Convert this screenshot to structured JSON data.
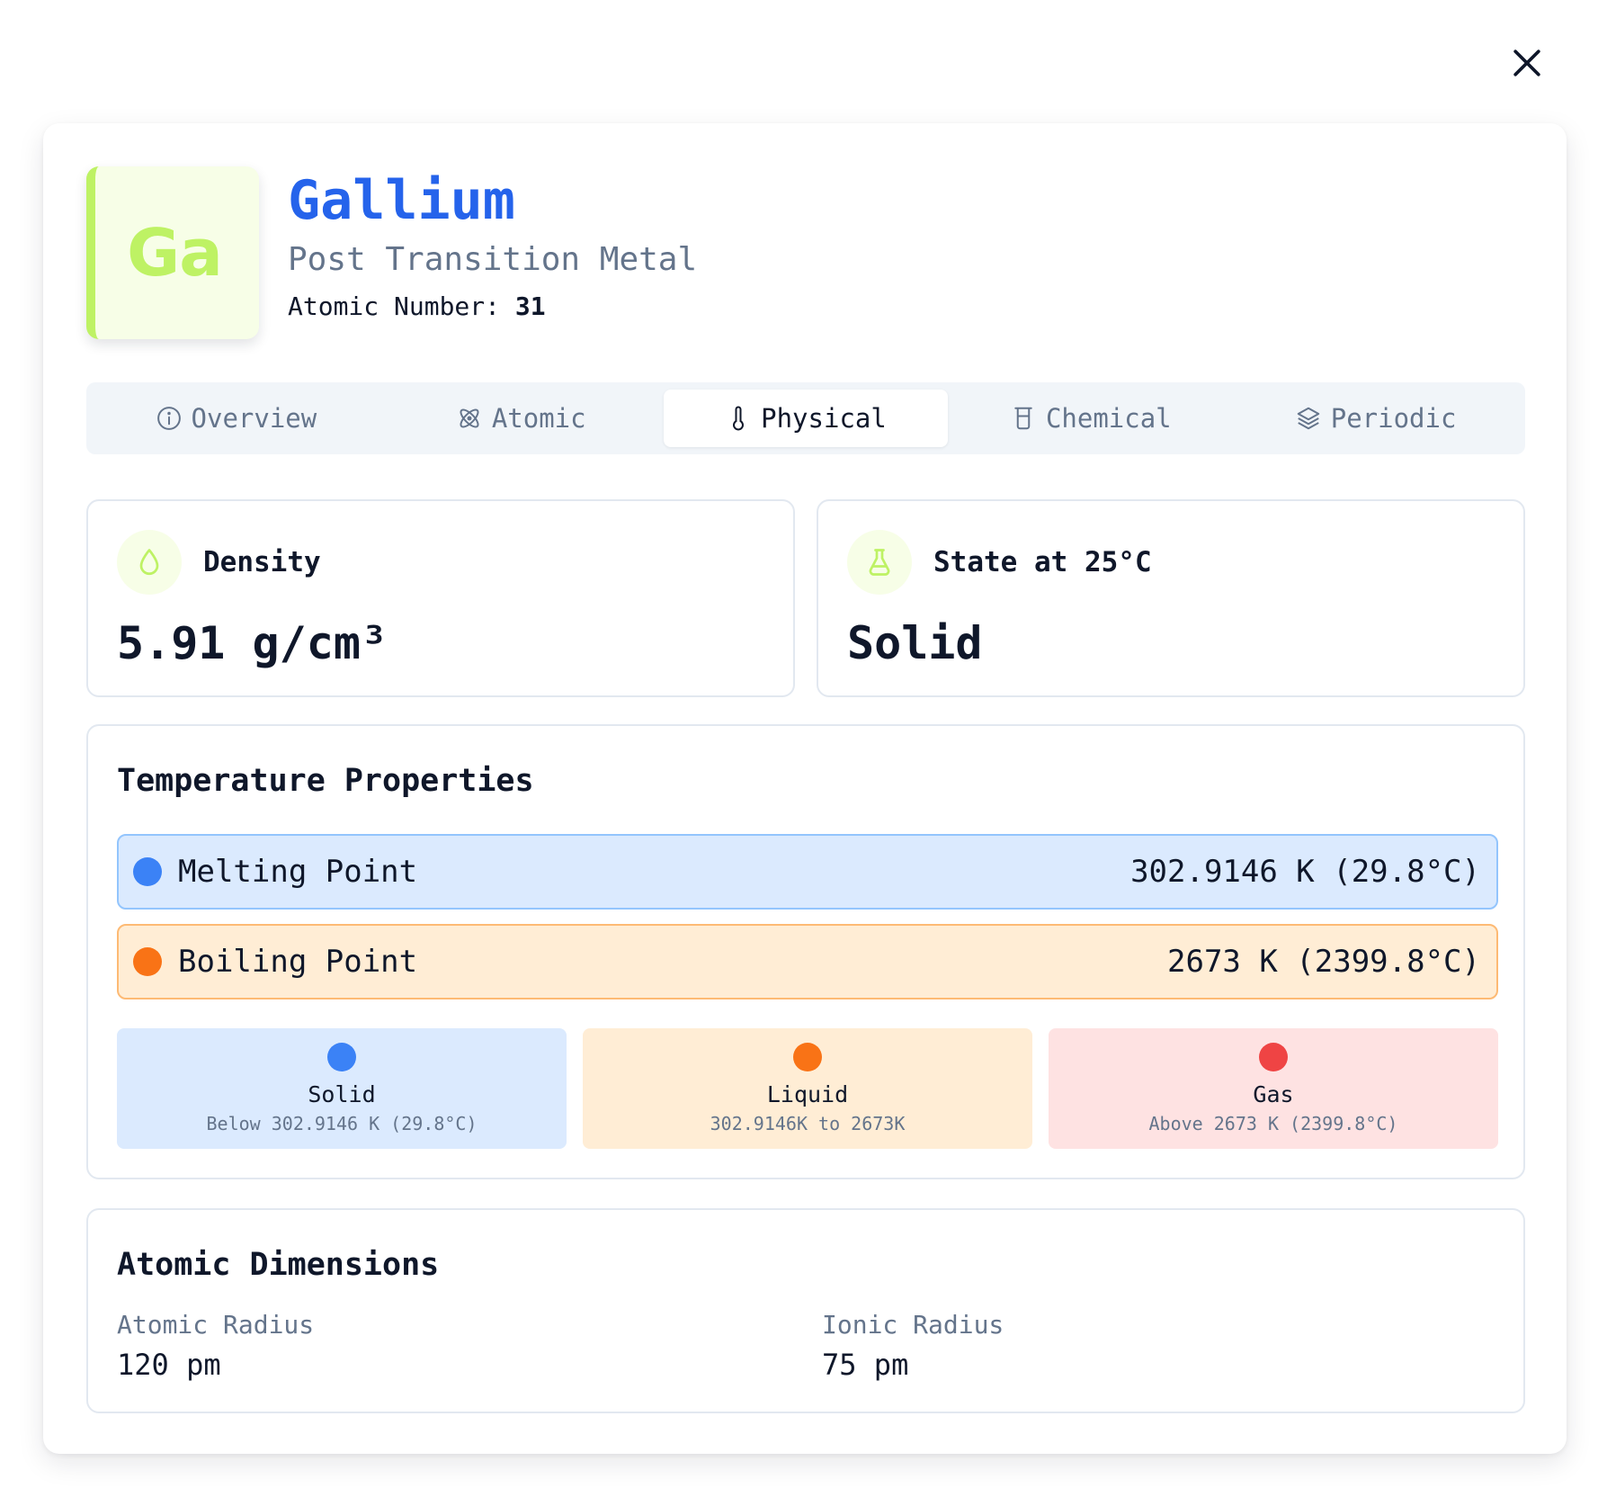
{
  "header": {
    "symbol": "Ga",
    "name": "Gallium",
    "category": "Post Transition Metal",
    "atomic_number_label": "Atomic Number:",
    "atomic_number": "31"
  },
  "tabs": [
    {
      "label": "Overview",
      "icon": "info-icon",
      "active": false
    },
    {
      "label": "Atomic",
      "icon": "atom-icon",
      "active": false
    },
    {
      "label": "Physical",
      "icon": "thermometer-icon",
      "active": true
    },
    {
      "label": "Chemical",
      "icon": "beaker-icon",
      "active": false
    },
    {
      "label": "Periodic",
      "icon": "layers-icon",
      "active": false
    }
  ],
  "density": {
    "label": "Density",
    "value": "5.91 g/cm³",
    "icon": "droplet-icon"
  },
  "state": {
    "label": "State at 25°C",
    "value": "Solid",
    "icon": "flask-icon"
  },
  "temperature": {
    "title": "Temperature Properties",
    "melting": {
      "label": "Melting Point",
      "value": "302.9146 K (29.8°C)"
    },
    "boiling": {
      "label": "Boiling Point",
      "value": "2673 K (2399.8°C)"
    },
    "phases": [
      {
        "name": "Solid",
        "range": "Below 302.9146 K (29.8°C)"
      },
      {
        "name": "Liquid",
        "range": "302.9146K to 2673K"
      },
      {
        "name": "Gas",
        "range": "Above 2673 K (2399.8°C)"
      }
    ]
  },
  "dimensions": {
    "title": "Atomic Dimensions",
    "atomic_radius_label": "Atomic Radius",
    "atomic_radius": "120 pm",
    "ionic_radius_label": "Ionic Radius",
    "ionic_radius": "75 pm"
  },
  "colors": {
    "accent": "#2563eb",
    "category": "#bef264",
    "solid": "#3b82f6",
    "liquid": "#f97316",
    "gas": "#ef4444"
  }
}
